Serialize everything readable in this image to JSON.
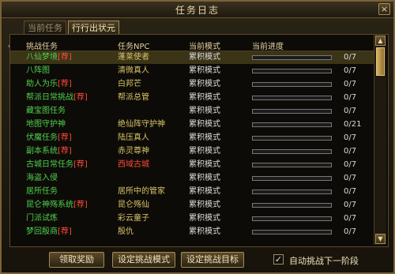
{
  "window": {
    "title": "任务日志",
    "close_icon": "×"
  },
  "tabs": [
    {
      "label": "当前任务",
      "active": false
    },
    {
      "label": "行行出状元",
      "active": true
    }
  ],
  "table": {
    "headers": {
      "task": "挑战任务",
      "npc": "任务NPC",
      "mode": "当前模式",
      "progress": "当前进度"
    },
    "rows": [
      {
        "name": "八仙梦境",
        "difficulty": "[荐]",
        "npc": "蓬莱使者",
        "mode": "累积模式",
        "progress_text": "0/7",
        "progress_fraction": 0,
        "selected": true
      },
      {
        "name": "八阵图",
        "difficulty": "",
        "npc": "清微真人",
        "mode": "累积模式",
        "progress_text": "0/7",
        "progress_fraction": 0
      },
      {
        "name": "助人为乐",
        "difficulty": "[荐]",
        "npc": "白邦芒",
        "mode": "累积模式",
        "progress_text": "0/7",
        "progress_fraction": 0
      },
      {
        "name": "帮派日常挑战",
        "difficulty": "[荐]",
        "npc": "帮派总管",
        "mode": "累积模式",
        "progress_text": "0/7",
        "progress_fraction": 0
      },
      {
        "name": "藏宝图任务",
        "difficulty": "",
        "npc": "",
        "mode": "累积模式",
        "progress_text": "0/7",
        "progress_fraction": 0
      },
      {
        "name": "地图守护神",
        "difficulty": "",
        "npc": "绝仙阵守护神",
        "mode": "累积模式",
        "progress_text": "0/21",
        "progress_fraction": 0
      },
      {
        "name": "伏魔任务",
        "difficulty": "[荐]",
        "npc": "陆压真人",
        "mode": "累积模式",
        "progress_text": "0/7",
        "progress_fraction": 0
      },
      {
        "name": "副本系统",
        "difficulty": "[荐]",
        "npc": "赤灵尊神",
        "mode": "累积模式",
        "progress_text": "0/7",
        "progress_fraction": 0
      },
      {
        "name": "古城日常任务",
        "difficulty": "[荐]",
        "npc": "西域古城",
        "npc_red": true,
        "mode": "累积模式",
        "progress_text": "0/7",
        "progress_fraction": 0
      },
      {
        "name": "海盗入侵",
        "difficulty": "",
        "npc": "",
        "mode": "累积模式",
        "progress_text": "0/7",
        "progress_fraction": 0
      },
      {
        "name": "居所任务",
        "difficulty": "",
        "npc": "居所中的管家",
        "mode": "累积模式",
        "progress_text": "0/7",
        "progress_fraction": 0
      },
      {
        "name": "昆仑神殇系统",
        "difficulty": "[荐]",
        "npc": "昆仑殇仙",
        "mode": "累积模式",
        "progress_text": "0/7",
        "progress_fraction": 0
      },
      {
        "name": "门派试炼",
        "difficulty": "",
        "npc": "彩云童子",
        "mode": "累积模式",
        "progress_text": "0/7",
        "progress_fraction": 0
      },
      {
        "name": "梦回殷商",
        "difficulty": "[荐]",
        "npc": "殷仇",
        "mode": "累积模式",
        "progress_text": "0/7",
        "progress_fraction": 0
      }
    ]
  },
  "scrollbar": {
    "up_icon": "▲",
    "down_icon": "▼"
  },
  "buttons": {
    "claim": "领取奖励",
    "set_mode": "设定挑战模式",
    "set_target": "设定挑战目标"
  },
  "auto_next": {
    "checked": true,
    "check_icon": "✓",
    "label": "自动挑战下一阶段"
  }
}
